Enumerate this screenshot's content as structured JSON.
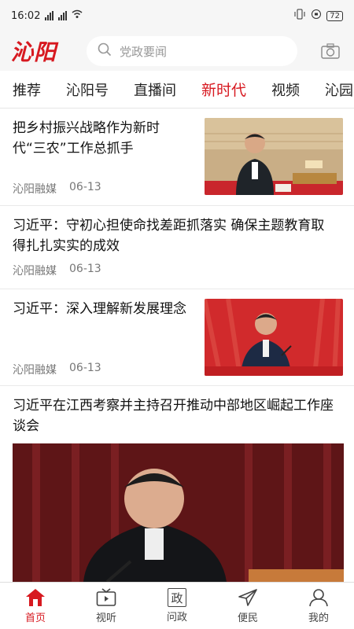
{
  "status_bar": {
    "time": "16:02",
    "network1": "4G",
    "network2": "4G",
    "battery": "72"
  },
  "header": {
    "logo": "沁阳",
    "search_placeholder": "党政要闻",
    "camera_icon": "camera-icon"
  },
  "tabs": [
    {
      "label": "推荐"
    },
    {
      "label": "沁阳号"
    },
    {
      "label": "直播间"
    },
    {
      "label": "新时代",
      "active": true
    },
    {
      "label": "视频"
    },
    {
      "label": "沁园春"
    }
  ],
  "articles": [
    {
      "title_line1": "把乡村振兴战略作为新时",
      "title_line2": "代“三农”工作总抓手",
      "source": "沁阳融媒",
      "date": "06-13"
    },
    {
      "title_line1": "习近平：守初心担使命找差距抓落实 确保主题教育取",
      "title_line2": "得扎扎实实的成效",
      "source": "沁阳融媒",
      "date": "06-13"
    },
    {
      "title_line1": "习近平：深入理解新发展理念",
      "title_line2": "",
      "source": "沁阳融媒",
      "date": "06-13"
    },
    {
      "title_line1": "习近平在江西考察并主持召开推动中部地区崛起工作座",
      "title_line2": "谈会"
    }
  ],
  "bottom_nav": [
    {
      "label": "首页",
      "icon": "home-icon",
      "active": true
    },
    {
      "label": "视听",
      "icon": "tv-icon"
    },
    {
      "label": "问政",
      "icon": "politics-icon",
      "glyph": "政"
    },
    {
      "label": "便民",
      "icon": "send-icon"
    },
    {
      "label": "我的",
      "icon": "user-icon"
    }
  ],
  "colors": {
    "accent": "#d71920",
    "stage_red": "#b5121b"
  }
}
